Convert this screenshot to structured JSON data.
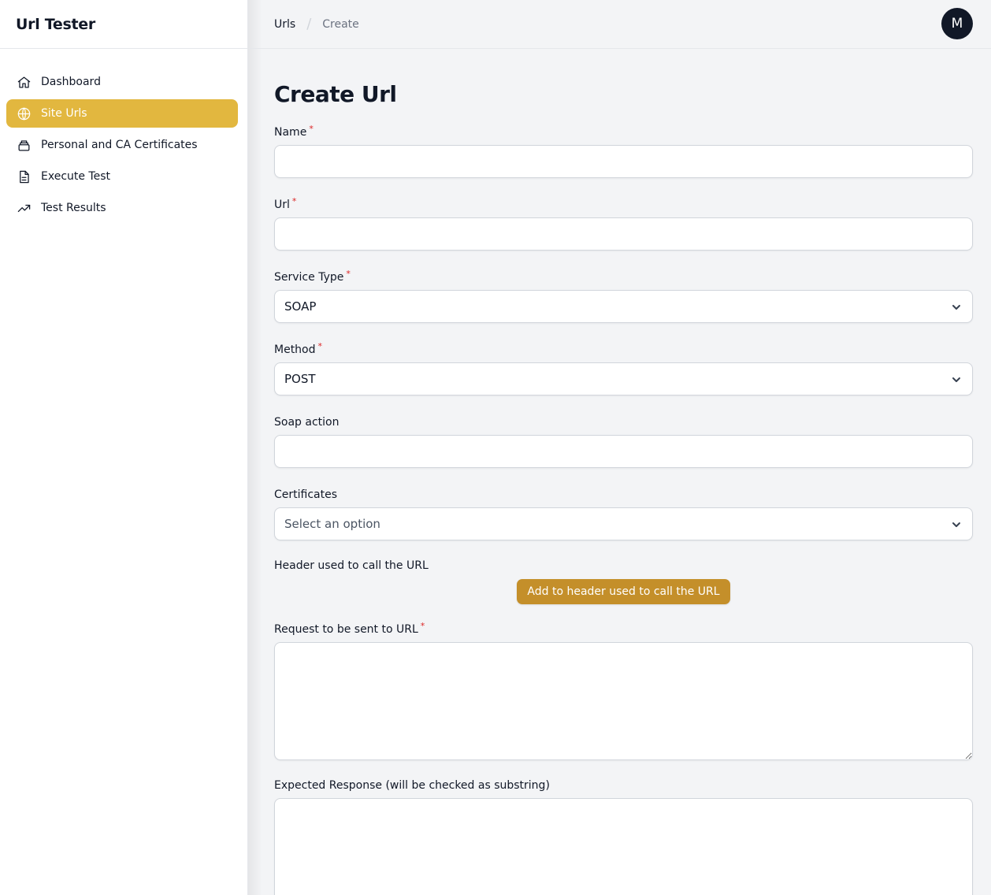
{
  "app": {
    "title": "Url Tester"
  },
  "sidebar": {
    "items": [
      {
        "label": "Dashboard",
        "icon": "home-icon",
        "active": false
      },
      {
        "label": "Site Urls",
        "icon": "globe-icon",
        "active": true
      },
      {
        "label": "Personal and CA Certificates",
        "icon": "archive-icon",
        "active": false
      },
      {
        "label": "Execute Test",
        "icon": "document-icon",
        "active": false
      },
      {
        "label": "Test Results",
        "icon": "trending-up-icon",
        "active": false
      }
    ]
  },
  "breadcrumb": {
    "parent": "Urls",
    "current": "Create"
  },
  "user": {
    "avatar_initial": "M"
  },
  "page": {
    "title": "Create Url"
  },
  "form": {
    "name": {
      "label": "Name",
      "required_mark": "*",
      "value": ""
    },
    "url": {
      "label": "Url",
      "required_mark": "*",
      "value": ""
    },
    "service_type": {
      "label": "Service Type",
      "required_mark": "*",
      "value": "SOAP"
    },
    "method": {
      "label": "Method",
      "required_mark": "*",
      "value": "POST"
    },
    "soap_action": {
      "label": "Soap action",
      "value": ""
    },
    "certificates": {
      "label": "Certificates",
      "placeholder": "Select an option"
    },
    "header": {
      "label": "Header used to call the URL",
      "add_button": "Add to header used to call the URL"
    },
    "request": {
      "label": "Request to be sent to URL",
      "required_mark": "*",
      "value": ""
    },
    "expected_response": {
      "label": "Expected Response (will be checked as substring)",
      "value": ""
    }
  },
  "colors": {
    "accent": "#e2b73f",
    "button": "#c48f2a",
    "required": "#dc2626",
    "avatar_bg": "#111827"
  }
}
